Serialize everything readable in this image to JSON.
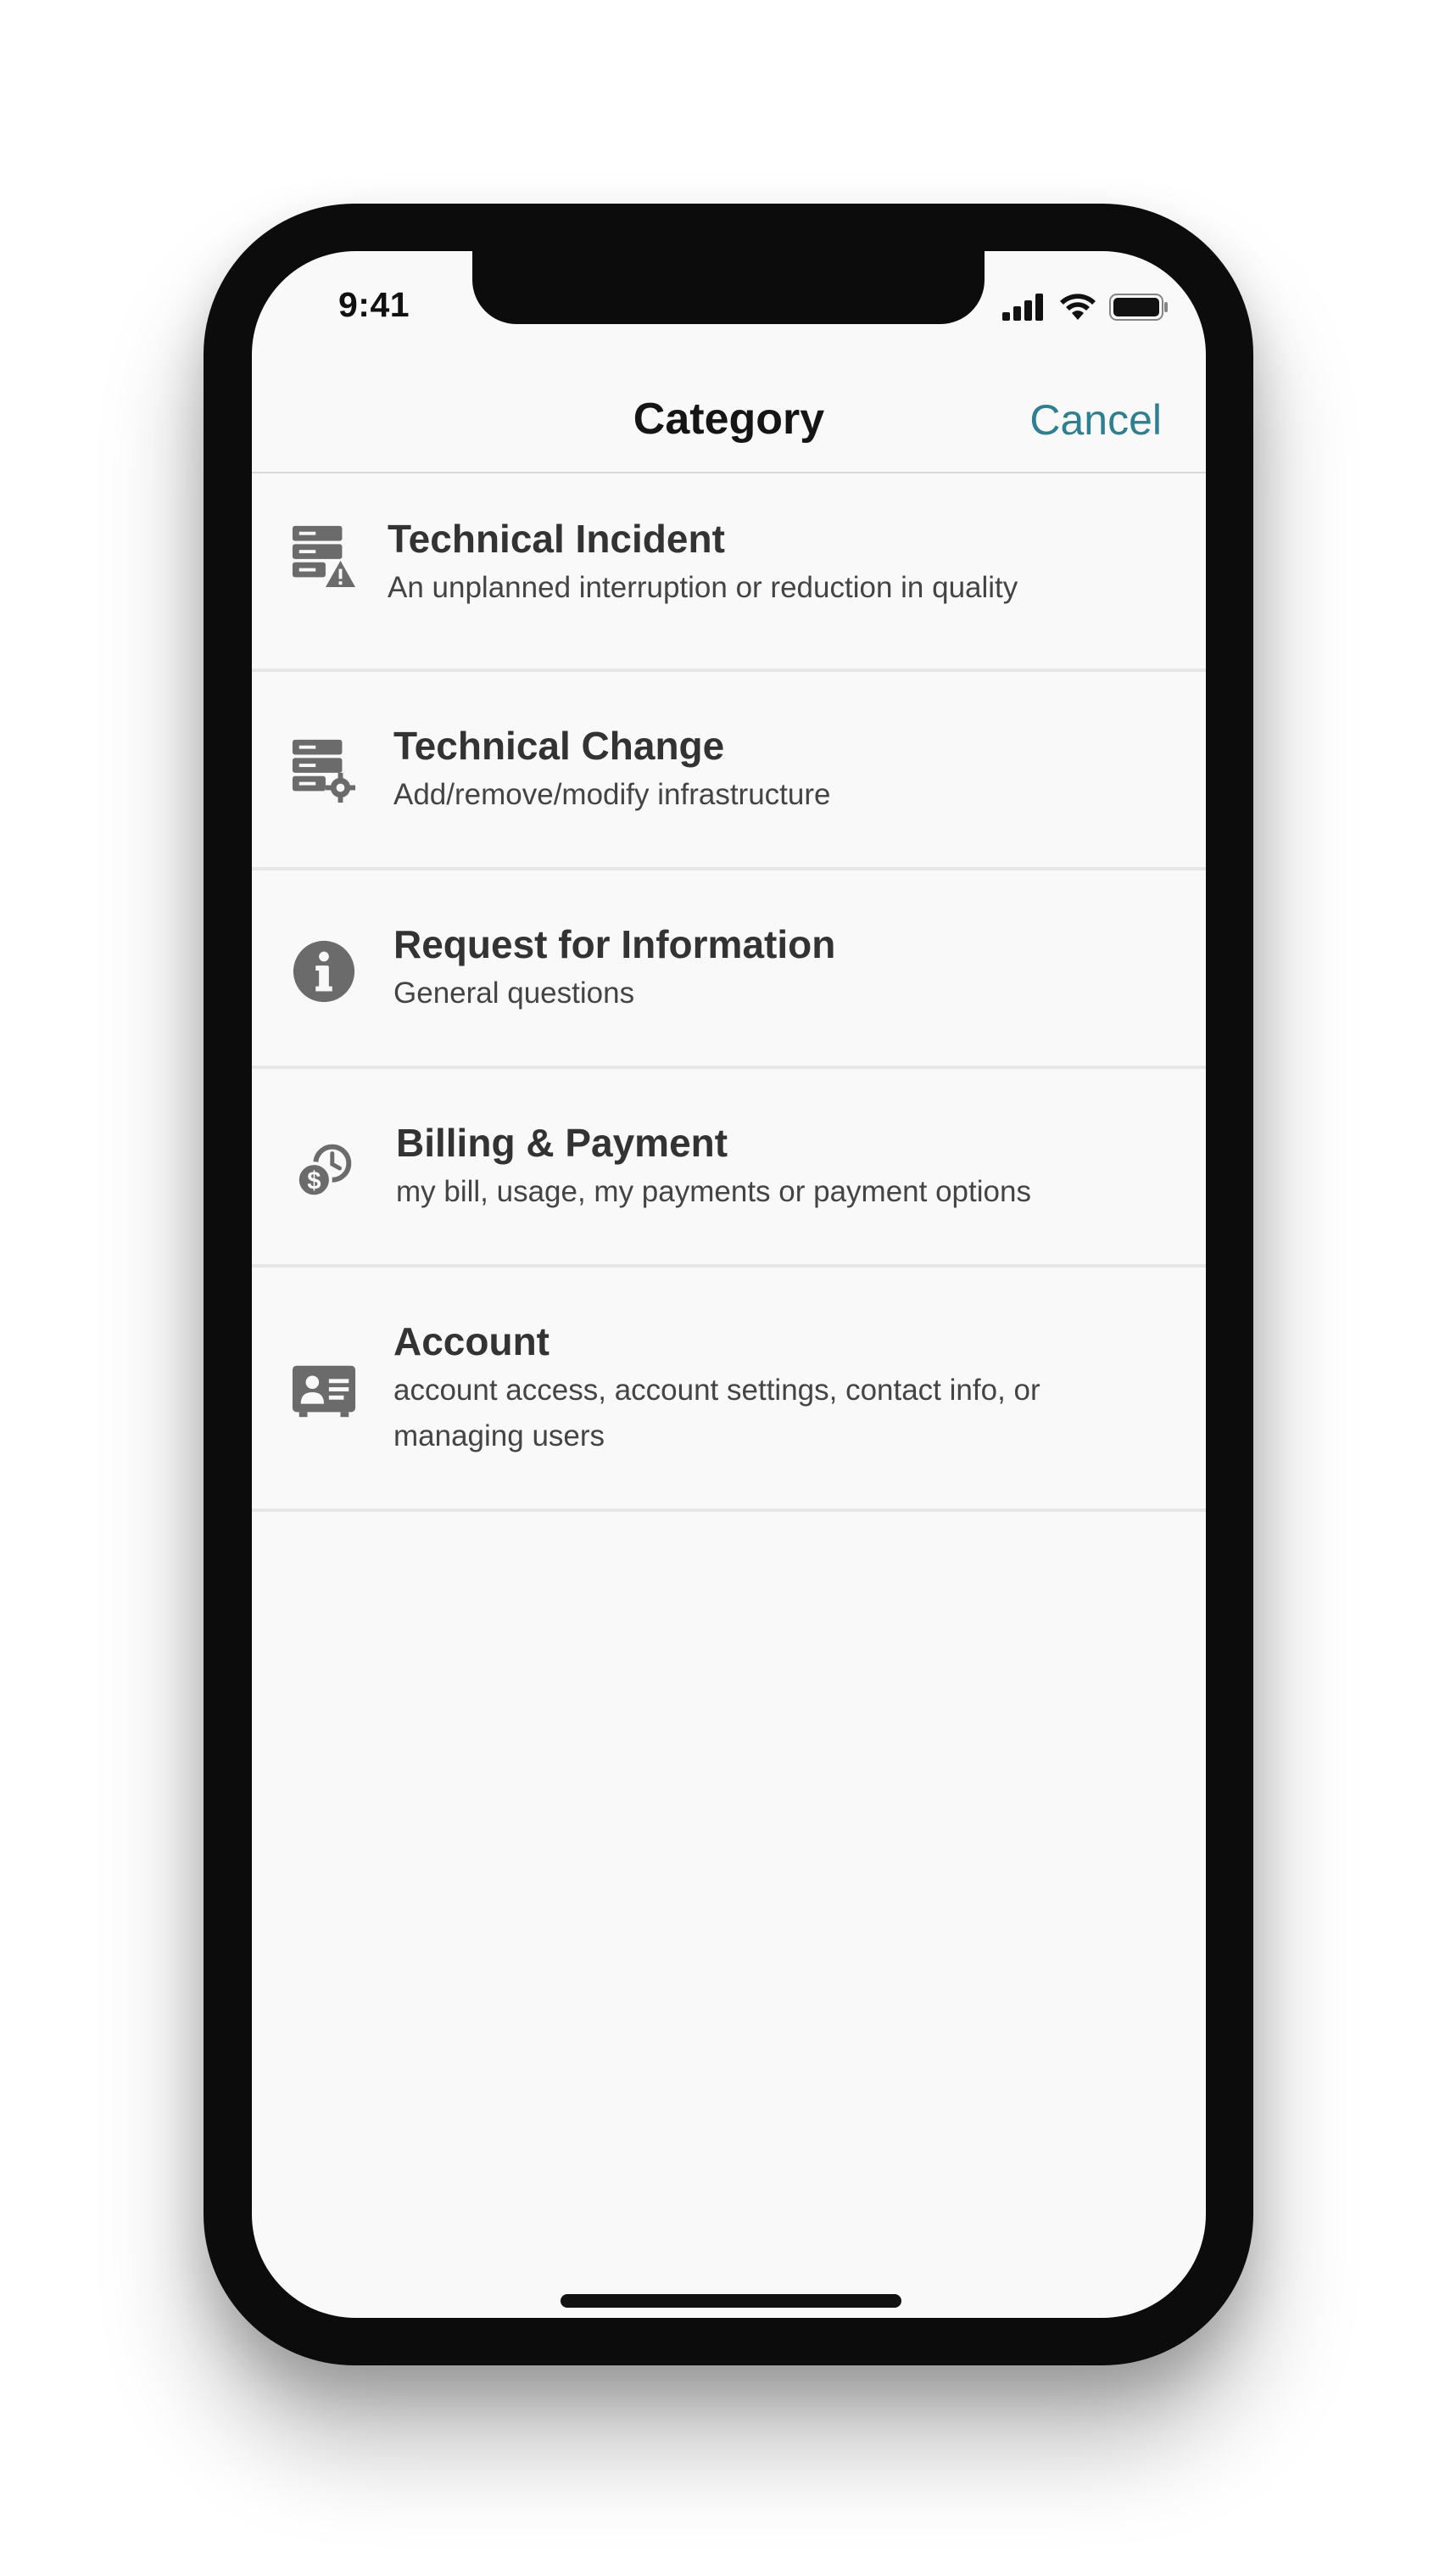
{
  "status_bar": {
    "time": "9:41",
    "icons": [
      "signal-icon",
      "wifi-icon",
      "battery-icon"
    ]
  },
  "nav": {
    "title": "Category",
    "cancel_label": "Cancel",
    "accent_color": "#2e7f8f"
  },
  "categories": [
    {
      "icon": "server-warning-icon",
      "title": "Technical Incident",
      "subtitle": "An unplanned interruption or reduction in quality"
    },
    {
      "icon": "server-gear-icon",
      "title": "Technical Change",
      "subtitle": "Add/remove/modify infrastructure"
    },
    {
      "icon": "info-icon",
      "title": "Request for Information",
      "subtitle": "General questions"
    },
    {
      "icon": "billing-clock-icon",
      "title": "Billing & Payment",
      "subtitle": "my bill, usage, my payments or payment options"
    },
    {
      "icon": "id-card-icon",
      "title": "Account",
      "subtitle": "account access, account settings, contact info, or managing users"
    }
  ]
}
